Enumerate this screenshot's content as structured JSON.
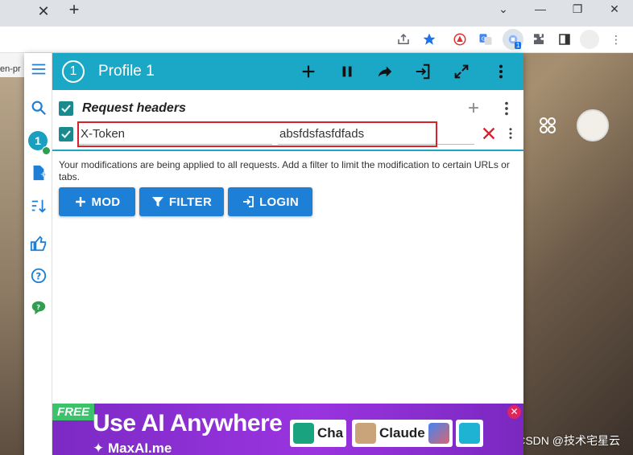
{
  "browser": {
    "tab_close_glyph": "✕",
    "new_tab_glyph": "+",
    "url_fragment": "en-pr",
    "extension_badge": "1"
  },
  "sidebar": {
    "profile_number": "1"
  },
  "header": {
    "profile_number": "1",
    "title": "Profile 1"
  },
  "request_headers": {
    "title": "Request headers",
    "checked": true,
    "rows": [
      {
        "name": "X-Token",
        "value": "absfdsfasfdfads",
        "checked": true
      }
    ]
  },
  "notice": "Your modifications are being applied to all requests. Add a filter to limit the modification to certain URLs or tabs.",
  "buttons": {
    "mod": "MOD",
    "filter": "FILTER",
    "login": "LOGIN"
  },
  "ad": {
    "badge": "FREE",
    "title": "Use AI Anywhere",
    "subtitle": "MaxAI.me",
    "chips": [
      "Cha",
      "Claude"
    ],
    "close_glyph": "✕"
  },
  "watermark": "CSDN @技术宅星云",
  "colors": {
    "header": "#1aa8c6",
    "checkbox": "#1a8a8f",
    "button": "#1e7fd6",
    "highlight": "#d9202e",
    "ad": "#9a34e0"
  }
}
